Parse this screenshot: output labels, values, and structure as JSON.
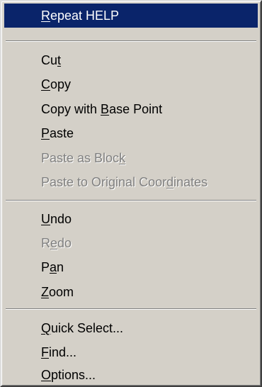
{
  "menu": {
    "colors": {
      "face": "#d4d0c8",
      "highlight": "#0a246a",
      "highlight_text": "#ffffff",
      "text": "#000000",
      "disabled_text": "#808080"
    },
    "repeat": {
      "a": "",
      "k": "R",
      "b": "epeat HELP"
    },
    "cut": {
      "a": "Cu",
      "k": "t",
      "b": ""
    },
    "copy": {
      "a": "",
      "k": "C",
      "b": "opy"
    },
    "copy_base": {
      "a": "Copy with ",
      "k": "B",
      "b": "ase Point"
    },
    "paste": {
      "a": "",
      "k": "P",
      "b": "aste"
    },
    "paste_block": {
      "a": "Paste as Bloc",
      "k": "k",
      "b": ""
    },
    "paste_orig": {
      "a": "Paste to Original Coor",
      "k": "d",
      "b": "inates"
    },
    "undo": {
      "a": "",
      "k": "U",
      "b": "ndo"
    },
    "redo": {
      "a": "R",
      "k": "e",
      "b": "do"
    },
    "pan": {
      "a": "P",
      "k": "a",
      "b": "n"
    },
    "zoom": {
      "a": "",
      "k": "Z",
      "b": "oom"
    },
    "quick_select": {
      "a": "",
      "k": "Q",
      "b": "uick Select..."
    },
    "find": {
      "a": "",
      "k": "F",
      "b": "ind..."
    },
    "options": {
      "a": "",
      "k": "O",
      "b": "ptions..."
    }
  }
}
